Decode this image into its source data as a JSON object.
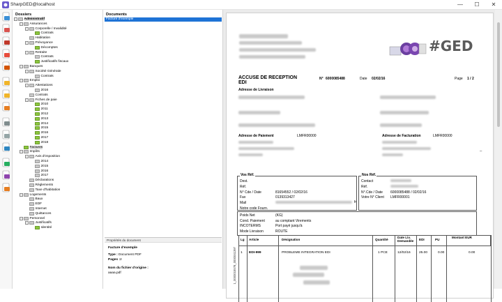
{
  "window": {
    "title": "SharpGED@localhost",
    "min": "—",
    "max": "☐",
    "close": "✕"
  },
  "toolbar": {
    "icons": [
      "ged-logo-icon",
      "add-document-icon",
      "add-pdf-icon",
      "delete-document-icon",
      "edit-pdf-icon",
      "new-folder-icon",
      "rename-folder-icon",
      "delete-folder-icon",
      "print-icon",
      "scanner-icon",
      "export-icon",
      "settings-icon",
      "help-icon",
      "exit-icon"
    ]
  },
  "tree": {
    "header": "Dossiers",
    "nodes": [
      {
        "label": "Administratif",
        "level": 0,
        "exp": "−",
        "color": "#c8c8c8",
        "sel": true,
        "bold": true
      },
      {
        "label": "Assurances",
        "level": 1,
        "exp": "−",
        "color": "#c8c8c8"
      },
      {
        "label": "Corporelle / Invalidité",
        "level": 2,
        "exp": "−",
        "color": "#c8c8c8"
      },
      {
        "label": "Contrats",
        "level": 3,
        "exp": "",
        "color": "#8cc63e"
      },
      {
        "label": "Habitation",
        "level": 2,
        "exp": "",
        "color": "#c8c8c8"
      },
      {
        "label": "Prévoyance",
        "level": 2,
        "exp": "−",
        "color": "#c8c8c8"
      },
      {
        "label": "Décomptes",
        "level": 3,
        "exp": "",
        "color": "#8cc63e"
      },
      {
        "label": "Retraite",
        "level": 2,
        "exp": "−",
        "color": "#c8c8c8"
      },
      {
        "label": "Contrats",
        "level": 3,
        "exp": "",
        "color": "#c8c8c8"
      },
      {
        "label": "Justificatifs fiscaux",
        "level": 3,
        "exp": "",
        "color": "#8cc63e"
      },
      {
        "label": "Banques",
        "level": 1,
        "exp": "−",
        "color": "#c8c8c8"
      },
      {
        "label": "Société Générale",
        "level": 2,
        "exp": "−",
        "color": "#c8c8c8"
      },
      {
        "label": "Contrats",
        "level": 3,
        "exp": "",
        "color": "#c8c8c8"
      },
      {
        "label": "Emploi",
        "level": 1,
        "exp": "−",
        "color": "#c8c8c8"
      },
      {
        "label": "Attestations",
        "level": 2,
        "exp": "−",
        "color": "#c8c8c8"
      },
      {
        "label": "2016",
        "level": 3,
        "exp": "",
        "color": "#c8c8c8"
      },
      {
        "label": "Contrats",
        "level": 2,
        "exp": "",
        "color": "#c8c8c8"
      },
      {
        "label": "Fiches de paie",
        "level": 2,
        "exp": "−",
        "color": "#c8c8c8"
      },
      {
        "label": "2010",
        "level": 3,
        "exp": "",
        "color": "#8cc63e"
      },
      {
        "label": "2011",
        "level": 3,
        "exp": "",
        "color": "#8cc63e"
      },
      {
        "label": "2012",
        "level": 3,
        "exp": "",
        "color": "#8cc63e"
      },
      {
        "label": "2013",
        "level": 3,
        "exp": "",
        "color": "#8cc63e"
      },
      {
        "label": "2014",
        "level": 3,
        "exp": "",
        "color": "#8cc63e"
      },
      {
        "label": "2015",
        "level": 3,
        "exp": "",
        "color": "#8cc63e"
      },
      {
        "label": "2016",
        "level": 3,
        "exp": "",
        "color": "#8cc63e"
      },
      {
        "label": "2017",
        "level": 3,
        "exp": "",
        "color": "#8cc63e"
      },
      {
        "label": "2018",
        "level": 3,
        "exp": "",
        "color": "#8cc63e"
      },
      {
        "label": "Factures",
        "level": 1,
        "exp": "",
        "color": "#8cc63e",
        "sel": true
      },
      {
        "label": "Impôts",
        "level": 1,
        "exp": "−",
        "color": "#c8c8c8"
      },
      {
        "label": "Avis d'imposition",
        "level": 2,
        "exp": "−",
        "color": "#c8c8c8"
      },
      {
        "label": "2014",
        "level": 3,
        "exp": "",
        "color": "#c8c8c8"
      },
      {
        "label": "2015",
        "level": 3,
        "exp": "",
        "color": "#c8c8c8"
      },
      {
        "label": "2016",
        "level": 3,
        "exp": "",
        "color": "#c8c8c8"
      },
      {
        "label": "2017",
        "level": 3,
        "exp": "",
        "color": "#c8c8c8"
      },
      {
        "label": "Déclarations",
        "level": 2,
        "exp": "",
        "color": "#c8c8c8"
      },
      {
        "label": "Règlements",
        "level": 2,
        "exp": "",
        "color": "#c8c8c8"
      },
      {
        "label": "Taxe d'habitation",
        "level": 2,
        "exp": "",
        "color": "#c8c8c8"
      },
      {
        "label": "Logements",
        "level": 1,
        "exp": "−",
        "color": "#c8c8c8"
      },
      {
        "label": "Baux",
        "level": 2,
        "exp": "",
        "color": "#c8c8c8"
      },
      {
        "label": "EDF",
        "level": 2,
        "exp": "",
        "color": "#c8c8c8"
      },
      {
        "label": "Internet",
        "level": 2,
        "exp": "",
        "color": "#c8c8c8"
      },
      {
        "label": "Quittances",
        "level": 2,
        "exp": "",
        "color": "#c8c8c8"
      },
      {
        "label": "Personnel",
        "level": 1,
        "exp": "−",
        "color": "#c8c8c8"
      },
      {
        "label": "Justificatifs",
        "level": 2,
        "exp": "−",
        "color": "#c8c8c8"
      },
      {
        "label": "Identité",
        "level": 3,
        "exp": "",
        "color": "#8cc63e"
      }
    ]
  },
  "documents": {
    "header": "Documents",
    "selected": "Facture d'exemple"
  },
  "properties": {
    "header": "Propriétés du document",
    "name": "Facture d'exemple",
    "type_label": "Type :",
    "type_value": "Document PDF",
    "pages_label": "Pages :",
    "pages_value": "2",
    "orig_label": "Nom du fichier d'origine :",
    "orig_value": "aaaa.pdf"
  },
  "doc": {
    "logo": "#GED",
    "title1": "ACCUSE DE RECEPTION",
    "title2": "EDI",
    "num_label": "N°",
    "num_value": "6000085488",
    "date_label": "Date",
    "date_value": "02/02/16",
    "page_label": "Page",
    "page_value": "1 / 2",
    "livraison": "Adresse de Livraison",
    "paiement": "Adresse de Paiement",
    "paiement_code": "LMFR00000",
    "facturation": "Adresse de Facturation",
    "facturation_code": "LMFR00000",
    "vosref": "Vos Réf.",
    "nosref": "Nos Réf.",
    "vos_lines": [
      "Dest.",
      "Réf.",
      "N° Cde / Date",
      "Fax",
      "Mail",
      "Notre code Fourn."
    ],
    "vos_vals": [
      "",
      "",
      "81654552 / 02/02/16",
      "0139313427",
      "",
      ""
    ],
    "nos_lines": [
      "Contact",
      "Réf.",
      "N°.Cde / Date",
      "Votre N° Client"
    ],
    "nos_vals": [
      "",
      "",
      "6000085488 / 02/02/16",
      "LMFR00001"
    ],
    "mail_suffix": "fr",
    "terms_labels": [
      "Poids Net",
      "Cond. Paiement",
      "INCOTERMS",
      "Mode Livraison"
    ],
    "terms_vals": [
      "(KG)",
      "au comptant  Virements",
      "Port payé jusqu'à",
      "ROUTE"
    ],
    "cols": [
      "Lg",
      "Article",
      "Désignation",
      "Quantité",
      "Date Liv. Demandée",
      "EDI",
      "PU",
      "Montant EUR"
    ],
    "row": [
      "1",
      "EDI-999",
      "PROBLEME INTEGRATION EDI",
      "1 PCE",
      "12/02/16",
      "25.00",
      "0.00",
      "0.00"
    ],
    "side_code": "1_0000015578_0000041397"
  }
}
